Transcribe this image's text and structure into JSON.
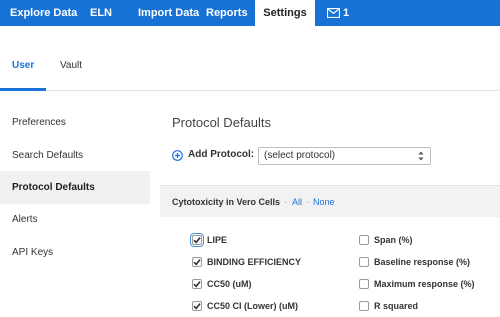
{
  "topnav": {
    "tabs": [
      {
        "label": "Explore Data",
        "active": false
      },
      {
        "label": "ELN",
        "active": false
      },
      {
        "label": "Import Data",
        "active": false
      },
      {
        "label": "Reports",
        "active": false
      },
      {
        "label": "Settings",
        "active": true
      }
    ],
    "mail": {
      "icon": "envelope-icon",
      "count": "1"
    },
    "color": "#1872d6"
  },
  "subnav": {
    "tabs": [
      {
        "label": "User",
        "active": true
      },
      {
        "label": "Vault",
        "active": false
      }
    ]
  },
  "sidebar": {
    "items": [
      {
        "label": "Preferences",
        "active": false
      },
      {
        "label": "Search Defaults",
        "active": false
      },
      {
        "label": "Protocol Defaults",
        "active": true
      },
      {
        "label": "Alerts",
        "active": false
      },
      {
        "label": "API Keys",
        "active": false
      }
    ]
  },
  "main": {
    "title": "Protocol Defaults",
    "add_protocol": {
      "icon": "plus-circle-icon",
      "label": "Add Protocol:",
      "select_value": "(select protocol)"
    },
    "panel": {
      "title": "Cytotoxicity in Vero Cells",
      "separator": "·",
      "all_label": "All",
      "none_label": "None",
      "left_options": [
        {
          "label": "LIPE",
          "checked": true
        },
        {
          "label": "BINDING EFFICIENCY",
          "checked": true
        },
        {
          "label": "CC50 (uM)",
          "checked": true
        },
        {
          "label": "CC50 CI (Lower) (uM)",
          "checked": true
        }
      ],
      "right_options": [
        {
          "label": "Span (%)",
          "checked": false
        },
        {
          "label": "Baseline response (%)",
          "checked": false
        },
        {
          "label": "Maximum response (%)",
          "checked": false
        },
        {
          "label": "R squared",
          "checked": false
        }
      ]
    }
  },
  "colors": {
    "accent": "#1a73d9",
    "active_sidebar_bg": "#f1f1f1",
    "panel_header_bg": "#f2f2f2"
  }
}
